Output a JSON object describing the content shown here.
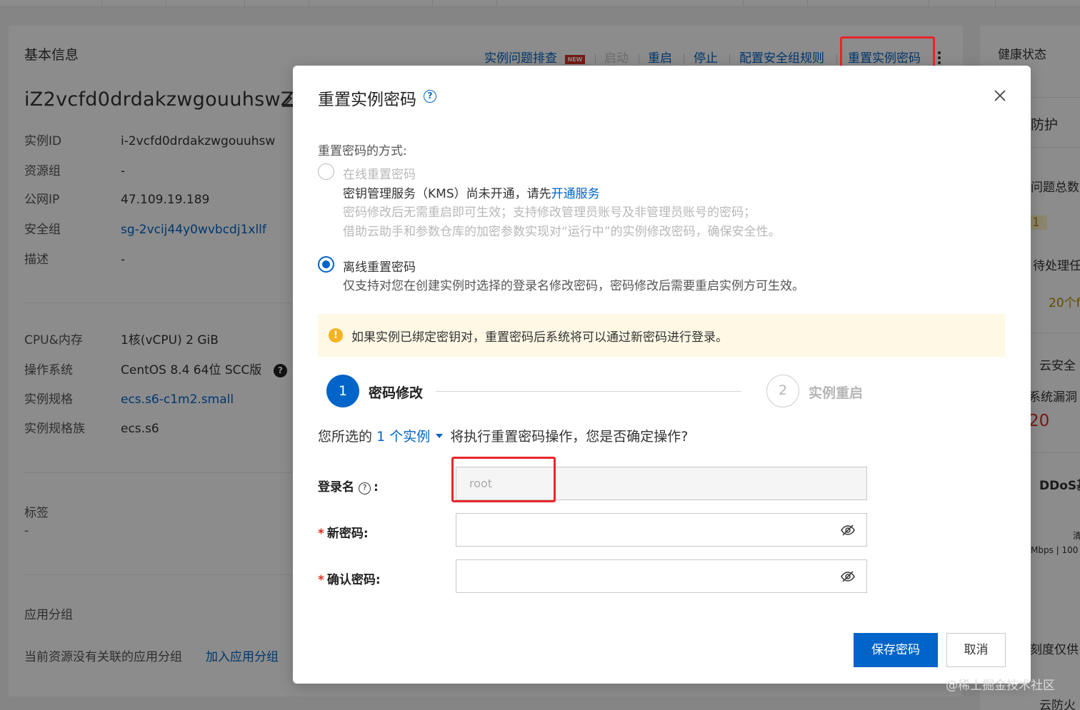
{
  "background": {
    "section_title": "基本信息",
    "instance_name": "iZ2vcfd0drdakzwgouuhswZ",
    "info": [
      {
        "key": "实例ID",
        "value": "i-2vcfd0drdakzwgouuhsw"
      },
      {
        "key": "资源组",
        "value": "-"
      },
      {
        "key": "公网IP",
        "value": "47.109.19.189"
      },
      {
        "key": "安全组",
        "value": "sg-2vcij44y0wvbcdj1xllf"
      },
      {
        "key": "描述",
        "value": "-"
      }
    ],
    "specs": [
      {
        "key": "CPU&内存",
        "value": "1核(vCPU) 2 GiB"
      },
      {
        "key": "操作系统",
        "value": "CentOS 8.4 64位 SCC版"
      },
      {
        "key": "实例规格",
        "value": "ecs.s6-c1m2.small"
      },
      {
        "key": "实例规格族",
        "value": "ecs.s6"
      }
    ],
    "os_help": "?",
    "tags_label": "标签",
    "tags_value": "-",
    "app_group_label": "应用分组",
    "app_group_empty": "当前资源没有关联的应用分组",
    "app_group_add": "加入应用分组",
    "actions": {
      "diagnose": "实例问题排查",
      "new_badge": "NEW",
      "start": "启动",
      "restart": "重启",
      "stop": "停止",
      "security_rules": "配置安全组规则",
      "reset_password": "重置实例密码"
    },
    "right_panel": {
      "health": "健康状态",
      "protect": "防护",
      "issue_total": "问题总数",
      "issue_count": "1",
      "pending": "待处理任",
      "pending_prefix": "",
      "pending_count": "20个f",
      "cloud_security": "云安全",
      "sys_vuln": "系统漏洞",
      "vuln_count": "20",
      "ddos": "DDoS基",
      "clean": "清",
      "bandwidth": "Mbps | 100",
      "only_for": "刻度仅供",
      "firewall": "云防火"
    },
    "watermark": "@稀土掘金技术社区"
  },
  "modal": {
    "title": "重置实例密码",
    "help_icon": "?",
    "method_label": "重置密码的方式:",
    "online": {
      "label": "在线重置密码",
      "kms_prefix": "密钥管理服务（KMS）尚未开通，请先",
      "kms_link": "开通服务",
      "desc1": "密码修改后无需重启即可生效；支持修改管理员账号及非管理员账号的密码；",
      "desc2": "借助云助手和参数仓库的加密参数实现对“运行中”的实例修改密码，确保安全性。"
    },
    "offline": {
      "label": "离线重置密码",
      "desc": "仅支持对您在创建实例时选择的登录名修改密码，密码修改后需要重启实例方可生效。"
    },
    "notice_icon": "!",
    "notice": "如果实例已绑定密钥对，重置密码后系统将可以通过新密码进行登录。",
    "steps": [
      {
        "num": "1",
        "label": "密码修改"
      },
      {
        "num": "2",
        "label": "实例重启"
      }
    ],
    "confirm_prefix": "您所选的",
    "confirm_link": "1 个实例",
    "confirm_suffix": "将执行重置密码操作，您是否确定操作?",
    "login_label": "登录名",
    "login_help": "?",
    "login_colon": ":",
    "login_value": "root",
    "new_pwd_label": "新密码",
    "confirm_pwd_label": "确认密码",
    "required_mark": "*",
    "field_colon": ":",
    "new_pwd_value": "",
    "confirm_pwd_value": "",
    "save_button": "保存密码",
    "cancel_button": "取消"
  },
  "colors": {
    "primary": "#0064c8",
    "highlight": "#e8262a",
    "notice_bg": "#fff8e5",
    "warning": "#f5b223"
  },
  "icons": {
    "close": "close-icon",
    "edit": "edit-icon",
    "eye_off": "eye-off-icon",
    "more": "more-vertical-icon"
  }
}
